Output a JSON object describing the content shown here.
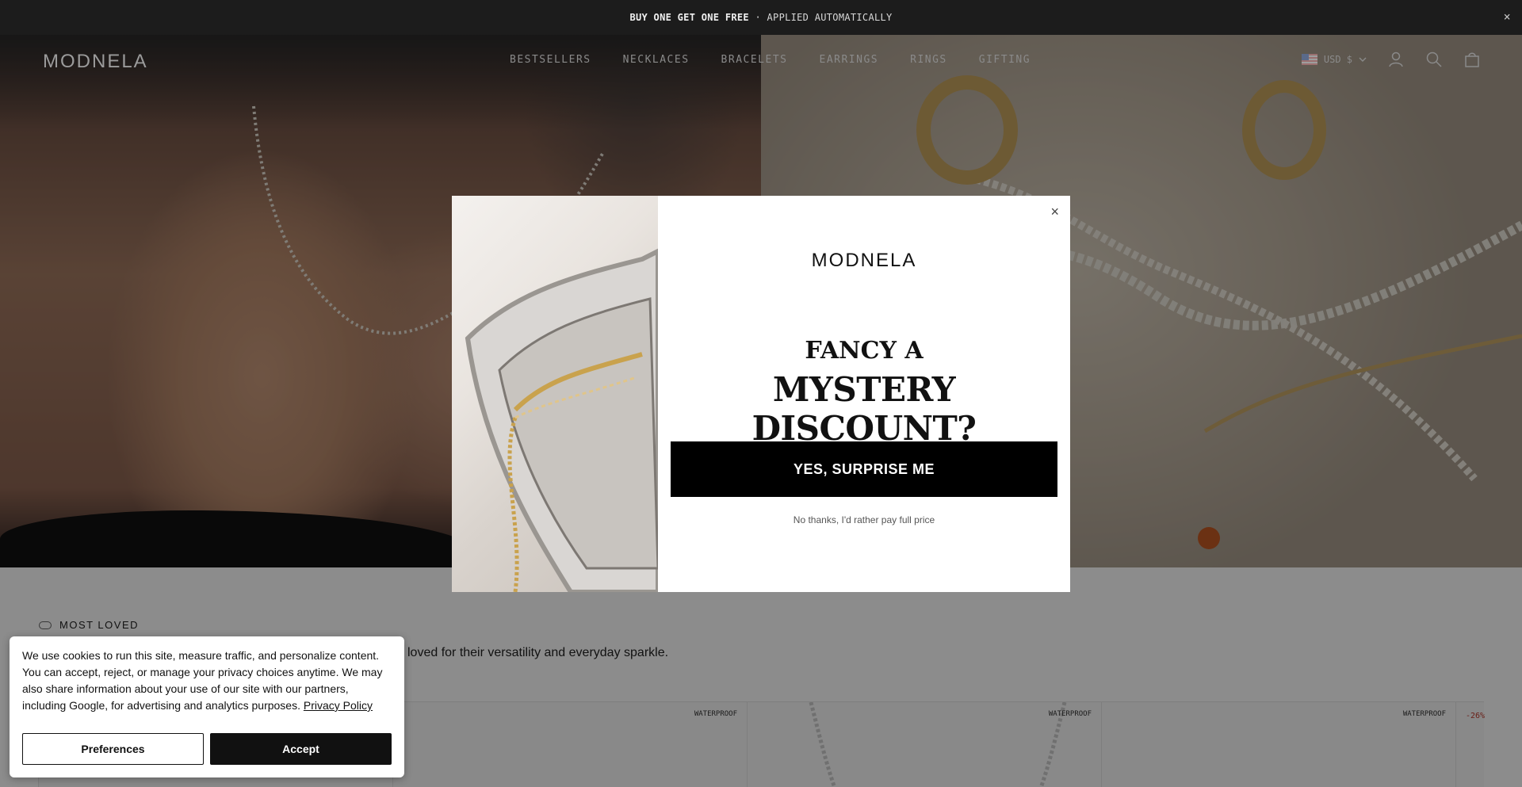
{
  "announcement": {
    "bold": "BUY ONE GET ONE FREE",
    "rest": " · APPLIED AUTOMATICALLY",
    "close_icon": "×"
  },
  "header": {
    "logo": "MODNELA",
    "nav": [
      "BESTSELLERS",
      "NECKLACES",
      "BRACELETS",
      "EARRINGS",
      "RINGS",
      "GIFTING"
    ],
    "currency": "USD $"
  },
  "section": {
    "eyebrow": "MOST LOVED",
    "subtitle": "loved for their versatility and everyday sparkle."
  },
  "products": [
    {
      "tag": "",
      "sale": ""
    },
    {
      "tag": "WATERPROOF",
      "sale": ""
    },
    {
      "tag": "WATERPROOF",
      "sale": ""
    },
    {
      "tag": "WATERPROOF",
      "sale": ""
    },
    {
      "tag": "",
      "sale": "-26%"
    }
  ],
  "modal": {
    "logo": "MODNELA",
    "headline_top": "FANCY A",
    "headline_bottom": "MYSTERY DISCOUNT?",
    "yes_button": "YES, SURPRISE ME",
    "no_link": "No thanks, I'd rather pay full price",
    "close_icon": "×"
  },
  "cookie": {
    "text": "We use cookies to run this site, measure traffic, and personalize content. You can accept, reject, or manage your privacy choices anytime. We may also share information about your use of our site with our partners, including Google, for advertising and analytics purposes. ",
    "link": "Privacy Policy",
    "preferences": "Preferences",
    "accept": "Accept"
  },
  "colors": {
    "announcement_bg": "#1c1c1c",
    "button_black": "#000000",
    "sale_red": "#c0392b"
  }
}
